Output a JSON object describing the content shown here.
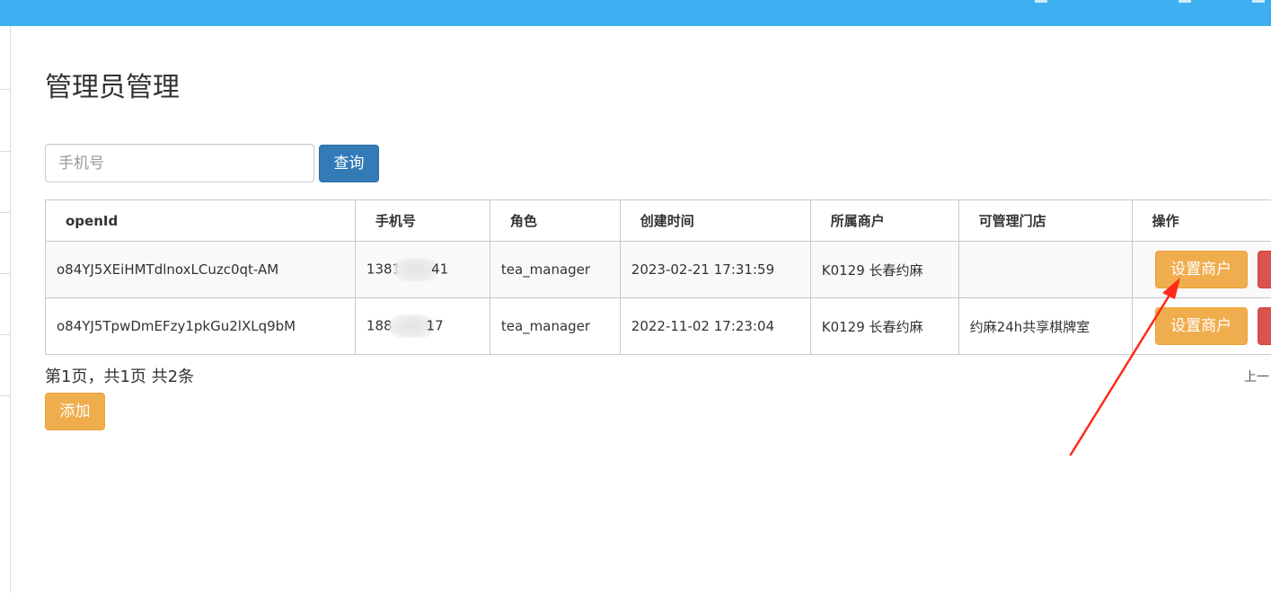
{
  "page": {
    "title": "管理员管理"
  },
  "search": {
    "placeholder": "手机号",
    "value": "",
    "button_label": "查询"
  },
  "table": {
    "headers": {
      "openid": "openId",
      "phone": "手机号",
      "role": "角色",
      "created": "创建时间",
      "merchant": "所属商户",
      "stores": "可管理门店",
      "actions": "操作"
    },
    "rows": [
      {
        "openid": "o84YJ5XEiHMTdlnoxLCuzc0qt-AM",
        "phone_prefix": "1381",
        "phone_suffix": "41",
        "role": "tea_manager",
        "created": "2023-02-21 17:31:59",
        "merchant": "K0129 长春约麻",
        "stores": "",
        "set_merchant_label": "设置商户"
      },
      {
        "openid": "o84YJ5TpwDmEFzy1pkGu2lXLq9bM",
        "phone_prefix": "188",
        "phone_suffix": "17",
        "role": "tea_manager",
        "created": "2022-11-02 17:23:04",
        "merchant": "K0129 长春约麻",
        "stores": "约麻24h共享棋牌室",
        "set_merchant_label": "设置商户"
      }
    ]
  },
  "pager": {
    "summary": "第1页，共1页 共2条",
    "prev_label": "上一"
  },
  "add_button_label": "添加",
  "colors": {
    "topbar": "#3cb0f0",
    "primary": "#337ab7",
    "warning": "#f0ad4e",
    "danger": "#d9534f",
    "annotation_arrow": "#ff2a1a"
  }
}
